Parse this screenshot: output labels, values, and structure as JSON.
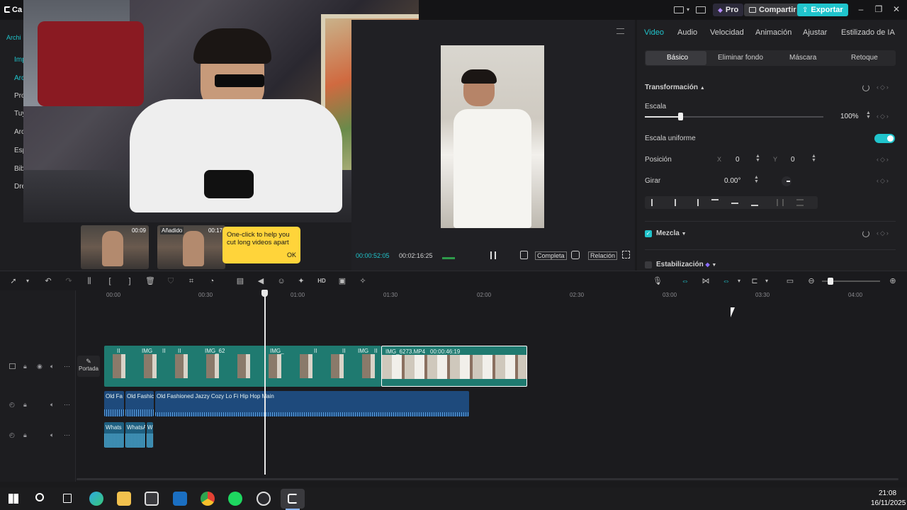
{
  "titlebar": {
    "app_name": "Ca",
    "pro_label": "Pro",
    "share_label": "Compartir",
    "export_label": "Exportar"
  },
  "left_panel": {
    "header": "Archi",
    "items": [
      "Imp",
      "Arc",
      "Pro",
      "Tuy",
      "Arc",
      "Esp",
      "Bib",
      "Dre"
    ]
  },
  "media": {
    "thumbs": [
      {
        "duration": "00:09",
        "tag": ""
      },
      {
        "duration": "00:17",
        "tag": "Añadido"
      }
    ],
    "tooltip": {
      "text": "One-click to help you cut long videos apart",
      "ok": "OK"
    }
  },
  "player": {
    "current_time": "00:00:52:05",
    "total_time": "00:02:16:25",
    "full_label": "Completa",
    "ratio_label": "Relación"
  },
  "right_panel": {
    "tabs": [
      "Video",
      "Audio",
      "Velocidad",
      "Animación",
      "Ajustar",
      "Estilizado de IA"
    ],
    "subtabs": [
      "Básico",
      "Eliminar fondo",
      "Máscara",
      "Retoque"
    ],
    "transform_title": "Transformación",
    "scale_label": "Escala",
    "scale_value": "100%",
    "scale_fraction": 0.2,
    "uniform_label": "Escala uniforme",
    "position_label": "Posición",
    "pos_x_axis": "X",
    "pos_x": "0",
    "pos_y_axis": "Y",
    "pos_y": "0",
    "rotate_label": "Girar",
    "rotate_value": "0.00°",
    "blend_label": "Mezcla",
    "stabilization_label": "Estabilización"
  },
  "timeline": {
    "ruler": [
      "00:00",
      "00:30",
      "01:00",
      "01:30",
      "02:00",
      "02:30",
      "03:00",
      "03:30",
      "04:00"
    ],
    "cover_label": "Portada",
    "clip_labels": [
      "II",
      "IMG",
      "II",
      "II",
      "IMG_62",
      "IMG_",
      "II",
      "II",
      "IMG",
      "II"
    ],
    "selected_clip": {
      "name": "IMG_6273.MP4",
      "duration": "00:00:46:19"
    },
    "audio_labels": [
      "Old Fa",
      "Old Fashic",
      "Old Fashioned Jazzy Cozy Lo Fi Hip Hop Main"
    ],
    "voice_labels": [
      "Whats",
      "WhatsA",
      "W"
    ]
  },
  "taskbar": {
    "time": "21:08",
    "date": "16/11/2025"
  },
  "colors": {
    "accent": "#20c4cc",
    "clip": "#1f7a70",
    "audio": "#1e4a7c",
    "tooltip": "#ffd43a"
  }
}
